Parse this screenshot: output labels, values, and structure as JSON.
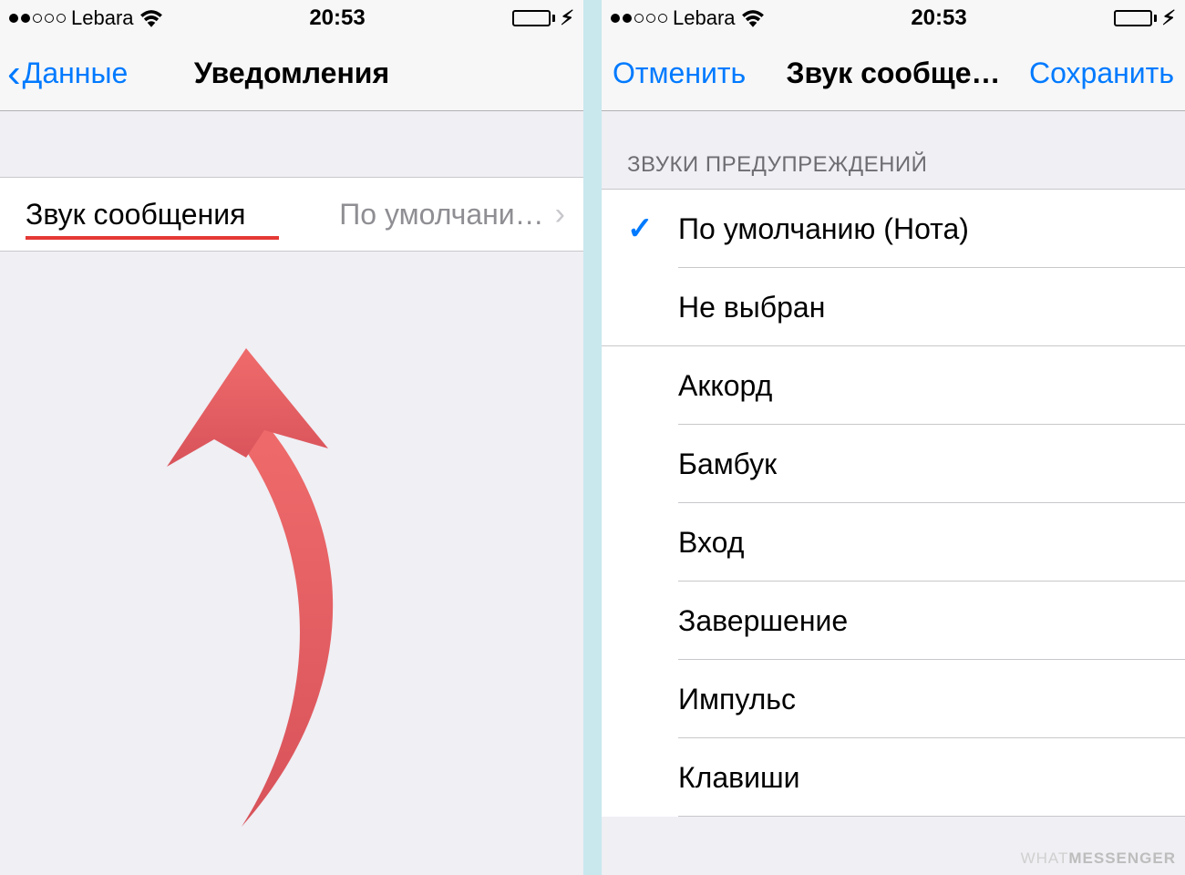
{
  "status": {
    "carrier": "Lebara",
    "time": "20:53"
  },
  "left_screen": {
    "nav": {
      "back": "Данные",
      "title": "Уведомления"
    },
    "cell": {
      "label": "Звук сообщения",
      "value": "По умолчани…"
    }
  },
  "right_screen": {
    "nav": {
      "cancel": "Отменить",
      "title": "Звук сообще…",
      "save": "Сохранить"
    },
    "section_header": "ЗВУКИ ПРЕДУПРЕЖДЕНИЙ",
    "sounds": [
      {
        "label": "По умолчанию (Нота)",
        "selected": true
      },
      {
        "label": "Не выбран",
        "selected": false
      },
      {
        "label": "Аккорд",
        "selected": false
      },
      {
        "label": "Бамбук",
        "selected": false
      },
      {
        "label": "Вход",
        "selected": false
      },
      {
        "label": "Завершение",
        "selected": false
      },
      {
        "label": "Импульс",
        "selected": false
      },
      {
        "label": "Клавиши",
        "selected": false
      }
    ]
  },
  "watermark": {
    "a": "WHAT",
    "b": "MESSENGER"
  }
}
